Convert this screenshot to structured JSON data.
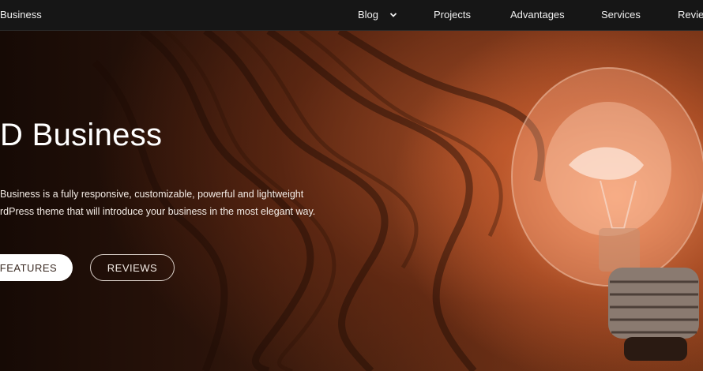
{
  "header": {
    "brand": "Business",
    "nav": [
      {
        "label": "Blog",
        "has_dropdown": true,
        "icon": "chevron-down-icon"
      },
      {
        "label": "Projects"
      },
      {
        "label": "Advantages"
      },
      {
        "label": "Services"
      },
      {
        "label": "Revie"
      }
    ]
  },
  "hero": {
    "title": "D Business",
    "description_line1": "Business is a fully responsive, customizable, powerful and lightweight",
    "description_line2": "rdPress theme that will introduce your business in the most elegant way.",
    "buttons": {
      "features": "FEATURES",
      "reviews": "REVIEWS"
    },
    "image": "light-bulb-on-wooden-table"
  },
  "colors": {
    "header_bg": "#161616",
    "button_primary_bg": "#ffffff",
    "accent_glow": "#ff965f"
  }
}
